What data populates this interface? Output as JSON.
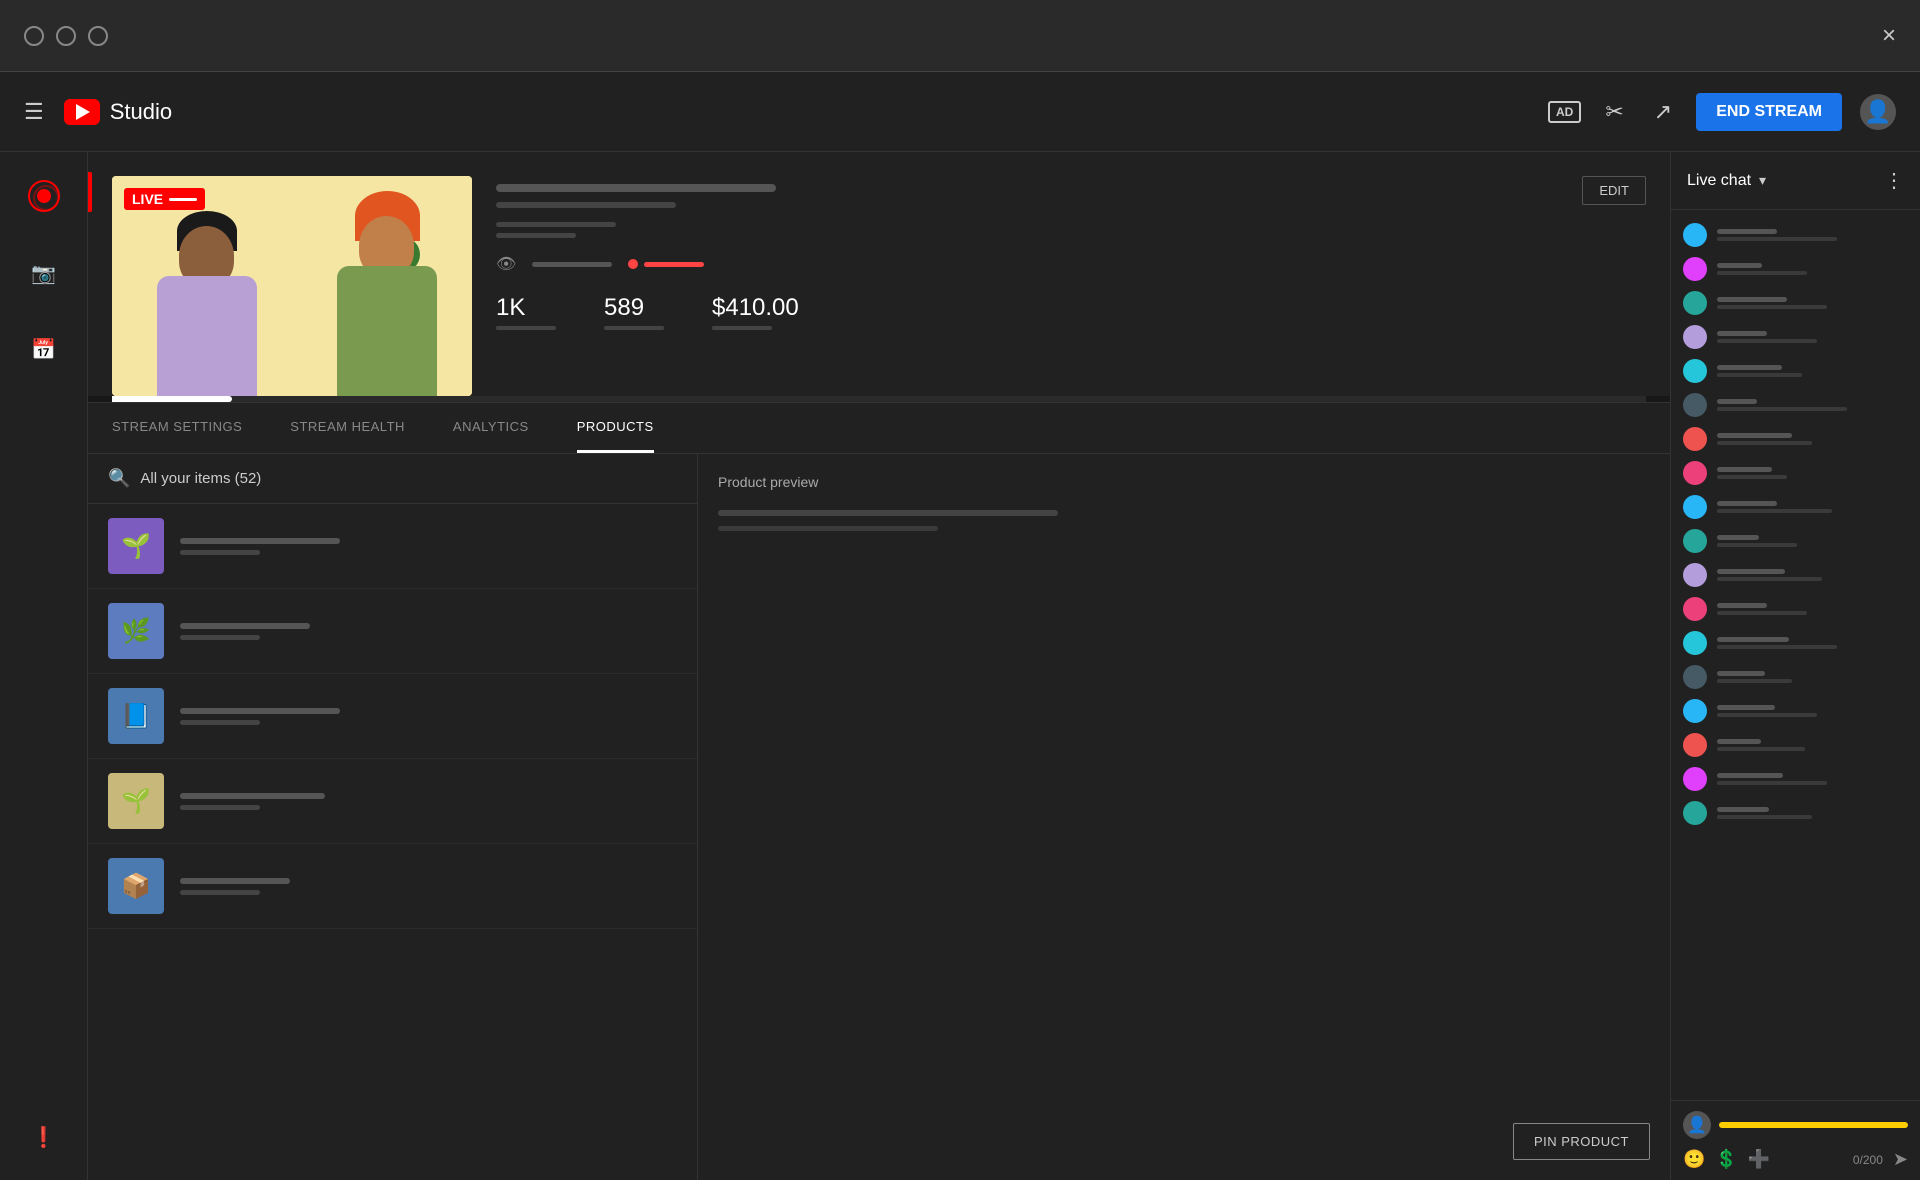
{
  "window": {
    "close_label": "×"
  },
  "topbar": {
    "menu_label": "☰",
    "logo_text": "Studio",
    "ad_badge": "AD",
    "end_stream_label": "END STREAM",
    "user_icon": "👤"
  },
  "stream": {
    "live_badge": "LIVE",
    "edit_btn": "EDIT",
    "stats": {
      "viewers": "1K",
      "likes": "589",
      "revenue": "$410.00"
    }
  },
  "tabs": [
    {
      "id": "stream-settings",
      "label": "STREAM SETTINGS",
      "active": false
    },
    {
      "id": "stream-health",
      "label": "STREAM HEALTH",
      "active": false
    },
    {
      "id": "analytics",
      "label": "ANALYTICS",
      "active": false
    },
    {
      "id": "products",
      "label": "PRODUCTS",
      "active": true
    }
  ],
  "products": {
    "search_text": "All your items (52)",
    "preview_title": "Product preview",
    "pin_btn": "PIN PRODUCT",
    "items": [
      {
        "id": 1,
        "color": "#7c5cbf",
        "emoji": "🌱",
        "title_width": 160,
        "bg": "#7c5cbf"
      },
      {
        "id": 2,
        "color": "#5c7cbf",
        "emoji": "🌿",
        "title_width": 130,
        "bg": "#5c7cbf"
      },
      {
        "id": 3,
        "color": "#4a7aaf",
        "emoji": "📘",
        "title_width": 160,
        "bg": "#4a7aaf"
      },
      {
        "id": 4,
        "color": "#c8b87a",
        "emoji": "🌱",
        "title_width": 145,
        "bg": "#c8b87a"
      },
      {
        "id": 5,
        "color": "#4a7aaf",
        "emoji": "📦",
        "title_width": 110,
        "bg": "#4a7aaf"
      }
    ]
  },
  "chat": {
    "title": "Live chat",
    "chevron": "▾",
    "more": "⋮",
    "input_count": "0/200",
    "messages": [
      {
        "avatar_color": "#29b6f6",
        "name_w": 60,
        "text_w": 120
      },
      {
        "avatar_color": "#e040fb",
        "name_w": 45,
        "text_w": 90
      },
      {
        "avatar_color": "#26a69a",
        "name_w": 70,
        "text_w": 110
      },
      {
        "avatar_color": "#b39ddb",
        "name_w": 50,
        "text_w": 100
      },
      {
        "avatar_color": "#26c6da",
        "name_w": 65,
        "text_w": 85
      },
      {
        "avatar_color": "#455a64",
        "name_w": 40,
        "text_w": 130
      },
      {
        "avatar_color": "#ef5350",
        "name_w": 75,
        "text_w": 95
      },
      {
        "avatar_color": "#ec407a",
        "name_w": 55,
        "text_w": 70
      },
      {
        "avatar_color": "#29b6f6",
        "name_w": 60,
        "text_w": 115
      },
      {
        "avatar_color": "#26a69a",
        "name_w": 42,
        "text_w": 80
      },
      {
        "avatar_color": "#b39ddb",
        "name_w": 68,
        "text_w": 105
      },
      {
        "avatar_color": "#ec407a",
        "name_w": 50,
        "text_w": 90
      },
      {
        "avatar_color": "#26c6da",
        "name_w": 72,
        "text_w": 120
      },
      {
        "avatar_color": "#455a64",
        "name_w": 48,
        "text_w": 75
      },
      {
        "avatar_color": "#29b6f6",
        "name_w": 58,
        "text_w": 100
      },
      {
        "avatar_color": "#ef5350",
        "name_w": 44,
        "text_w": 88
      },
      {
        "avatar_color": "#e040fb",
        "name_w": 66,
        "text_w": 110
      },
      {
        "avatar_color": "#26a69a",
        "name_w": 52,
        "text_w": 95
      }
    ]
  }
}
